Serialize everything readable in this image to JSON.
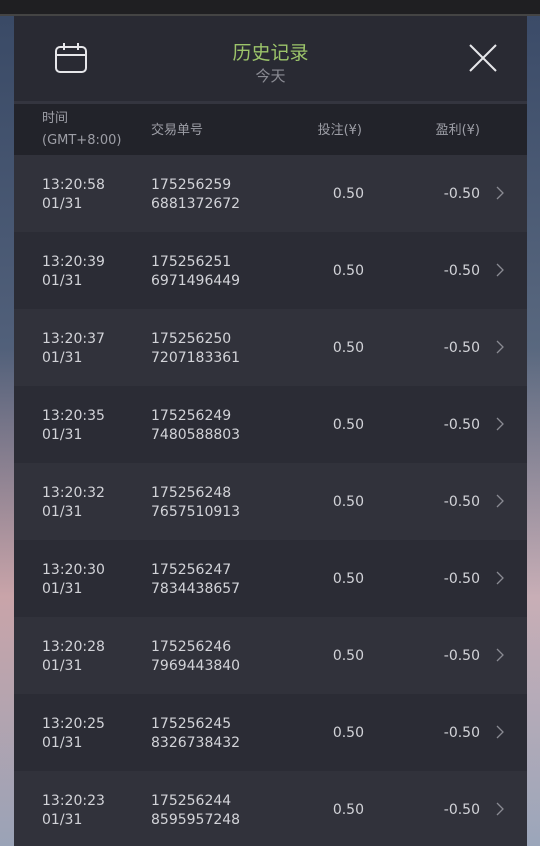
{
  "header": {
    "title": "历史记录",
    "subtitle": "今天",
    "calendar_icon": "calendar-icon",
    "close_icon": "close-icon"
  },
  "columns": {
    "time_line1": "时间",
    "time_line2": "(GMT+8:00)",
    "order_id": "交易单号",
    "bet": "投注(¥)",
    "profit": "盈利(¥)"
  },
  "rows": [
    {
      "time": "13:20:58",
      "date": "01/31",
      "id1": "175256259",
      "id2": "6881372672",
      "bet": "0.50",
      "profit": "-0.50"
    },
    {
      "time": "13:20:39",
      "date": "01/31",
      "id1": "175256251",
      "id2": "6971496449",
      "bet": "0.50",
      "profit": "-0.50"
    },
    {
      "time": "13:20:37",
      "date": "01/31",
      "id1": "175256250",
      "id2": "7207183361",
      "bet": "0.50",
      "profit": "-0.50"
    },
    {
      "time": "13:20:35",
      "date": "01/31",
      "id1": "175256249",
      "id2": "7480588803",
      "bet": "0.50",
      "profit": "-0.50"
    },
    {
      "time": "13:20:32",
      "date": "01/31",
      "id1": "175256248",
      "id2": "7657510913",
      "bet": "0.50",
      "profit": "-0.50"
    },
    {
      "time": "13:20:30",
      "date": "01/31",
      "id1": "175256247",
      "id2": "7834438657",
      "bet": "0.50",
      "profit": "-0.50"
    },
    {
      "time": "13:20:28",
      "date": "01/31",
      "id1": "175256246",
      "id2": "7969443840",
      "bet": "0.50",
      "profit": "-0.50"
    },
    {
      "time": "13:20:25",
      "date": "01/31",
      "id1": "175256245",
      "id2": "8326738432",
      "bet": "0.50",
      "profit": "-0.50"
    },
    {
      "time": "13:20:23",
      "date": "01/31",
      "id1": "175256244",
      "id2": "8595957248",
      "bet": "0.50",
      "profit": "-0.50"
    }
  ],
  "colors": {
    "title": "#9cc46a",
    "panel": "#2b2b33"
  }
}
